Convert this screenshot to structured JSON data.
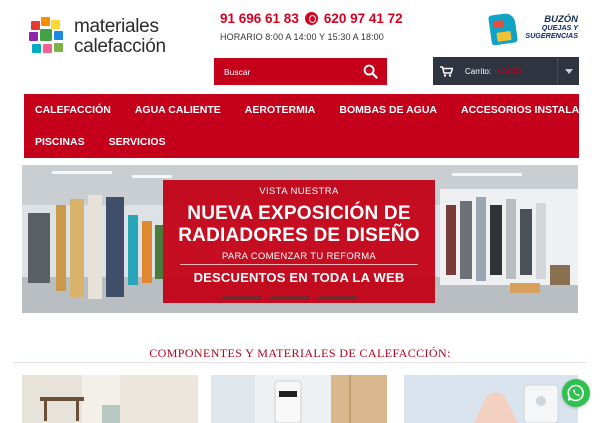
{
  "brand": {
    "name_line1": "materiales",
    "name_line2": "calefacción",
    "logo_colors": [
      "#e53935",
      "#fb8c00",
      "#fdd835",
      "#43a047",
      "#1e88e5",
      "#8e24aa",
      "#00acc1",
      "#f06292",
      "#7cb342"
    ]
  },
  "contact": {
    "phone": "91 696 61 83",
    "whatsapp": "620 97 41 72",
    "hours": "HORARIO 8:00 A 14:00 Y 15:30 A 18:00",
    "icon": "whatsapp-icon"
  },
  "buzon": {
    "line1": "BUZÓN",
    "line2": "QUEJAS Y",
    "line3": "SUGERENCIAS",
    "icon": "mailbox-icon"
  },
  "search": {
    "placeholder": "Buscar",
    "icon": "search-icon"
  },
  "cart": {
    "label": "Carrito:",
    "value": "VACÍO",
    "icon": "cart-icon"
  },
  "nav": {
    "row1": [
      "CALEFACCIÓN",
      "AGUA CALIENTE",
      "AEROTERMIA",
      "BOMBAS DE AGUA",
      "ACCESORIOS INSTALACIÓN"
    ],
    "row2": [
      "PISCINAS",
      "SERVICIOS"
    ]
  },
  "hero": {
    "kicker": "VISTA NUESTRA",
    "title_line1": "NUEVA EXPOSICIÓN DE",
    "title_line2": "RADIADORES DE DISEÑO",
    "subtitle": "PARA COMENZAR TU REFORMA",
    "cta": "DESCUENTOS EN TODA LA WEB",
    "slides": 3
  },
  "section": {
    "title": "COMPONENTES Y MATERIALES DE CALEFACCIÓN:"
  },
  "colors": {
    "brand_red": "#c4001b",
    "phone_red": "#d8001f",
    "cart_dark": "#2e3440",
    "whatsapp_green": "#2fc150"
  }
}
